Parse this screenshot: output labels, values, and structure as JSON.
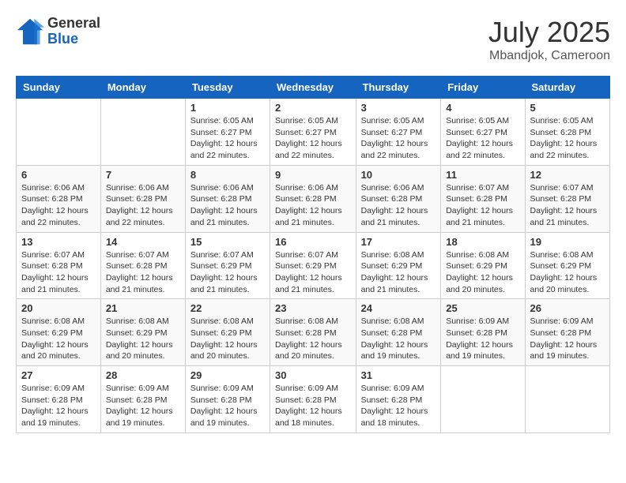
{
  "header": {
    "logo_general": "General",
    "logo_blue": "Blue",
    "month_title": "July 2025",
    "location": "Mbandjok, Cameroon"
  },
  "weekdays": [
    "Sunday",
    "Monday",
    "Tuesday",
    "Wednesday",
    "Thursday",
    "Friday",
    "Saturday"
  ],
  "weeks": [
    [
      {
        "day": "",
        "info": ""
      },
      {
        "day": "",
        "info": ""
      },
      {
        "day": "1",
        "info": "Sunrise: 6:05 AM\nSunset: 6:27 PM\nDaylight: 12 hours and 22 minutes."
      },
      {
        "day": "2",
        "info": "Sunrise: 6:05 AM\nSunset: 6:27 PM\nDaylight: 12 hours and 22 minutes."
      },
      {
        "day": "3",
        "info": "Sunrise: 6:05 AM\nSunset: 6:27 PM\nDaylight: 12 hours and 22 minutes."
      },
      {
        "day": "4",
        "info": "Sunrise: 6:05 AM\nSunset: 6:27 PM\nDaylight: 12 hours and 22 minutes."
      },
      {
        "day": "5",
        "info": "Sunrise: 6:05 AM\nSunset: 6:28 PM\nDaylight: 12 hours and 22 minutes."
      }
    ],
    [
      {
        "day": "6",
        "info": "Sunrise: 6:06 AM\nSunset: 6:28 PM\nDaylight: 12 hours and 22 minutes."
      },
      {
        "day": "7",
        "info": "Sunrise: 6:06 AM\nSunset: 6:28 PM\nDaylight: 12 hours and 22 minutes."
      },
      {
        "day": "8",
        "info": "Sunrise: 6:06 AM\nSunset: 6:28 PM\nDaylight: 12 hours and 21 minutes."
      },
      {
        "day": "9",
        "info": "Sunrise: 6:06 AM\nSunset: 6:28 PM\nDaylight: 12 hours and 21 minutes."
      },
      {
        "day": "10",
        "info": "Sunrise: 6:06 AM\nSunset: 6:28 PM\nDaylight: 12 hours and 21 minutes."
      },
      {
        "day": "11",
        "info": "Sunrise: 6:07 AM\nSunset: 6:28 PM\nDaylight: 12 hours and 21 minutes."
      },
      {
        "day": "12",
        "info": "Sunrise: 6:07 AM\nSunset: 6:28 PM\nDaylight: 12 hours and 21 minutes."
      }
    ],
    [
      {
        "day": "13",
        "info": "Sunrise: 6:07 AM\nSunset: 6:28 PM\nDaylight: 12 hours and 21 minutes."
      },
      {
        "day": "14",
        "info": "Sunrise: 6:07 AM\nSunset: 6:28 PM\nDaylight: 12 hours and 21 minutes."
      },
      {
        "day": "15",
        "info": "Sunrise: 6:07 AM\nSunset: 6:29 PM\nDaylight: 12 hours and 21 minutes."
      },
      {
        "day": "16",
        "info": "Sunrise: 6:07 AM\nSunset: 6:29 PM\nDaylight: 12 hours and 21 minutes."
      },
      {
        "day": "17",
        "info": "Sunrise: 6:08 AM\nSunset: 6:29 PM\nDaylight: 12 hours and 21 minutes."
      },
      {
        "day": "18",
        "info": "Sunrise: 6:08 AM\nSunset: 6:29 PM\nDaylight: 12 hours and 20 minutes."
      },
      {
        "day": "19",
        "info": "Sunrise: 6:08 AM\nSunset: 6:29 PM\nDaylight: 12 hours and 20 minutes."
      }
    ],
    [
      {
        "day": "20",
        "info": "Sunrise: 6:08 AM\nSunset: 6:29 PM\nDaylight: 12 hours and 20 minutes."
      },
      {
        "day": "21",
        "info": "Sunrise: 6:08 AM\nSunset: 6:29 PM\nDaylight: 12 hours and 20 minutes."
      },
      {
        "day": "22",
        "info": "Sunrise: 6:08 AM\nSunset: 6:29 PM\nDaylight: 12 hours and 20 minutes."
      },
      {
        "day": "23",
        "info": "Sunrise: 6:08 AM\nSunset: 6:28 PM\nDaylight: 12 hours and 20 minutes."
      },
      {
        "day": "24",
        "info": "Sunrise: 6:08 AM\nSunset: 6:28 PM\nDaylight: 12 hours and 19 minutes."
      },
      {
        "day": "25",
        "info": "Sunrise: 6:09 AM\nSunset: 6:28 PM\nDaylight: 12 hours and 19 minutes."
      },
      {
        "day": "26",
        "info": "Sunrise: 6:09 AM\nSunset: 6:28 PM\nDaylight: 12 hours and 19 minutes."
      }
    ],
    [
      {
        "day": "27",
        "info": "Sunrise: 6:09 AM\nSunset: 6:28 PM\nDaylight: 12 hours and 19 minutes."
      },
      {
        "day": "28",
        "info": "Sunrise: 6:09 AM\nSunset: 6:28 PM\nDaylight: 12 hours and 19 minutes."
      },
      {
        "day": "29",
        "info": "Sunrise: 6:09 AM\nSunset: 6:28 PM\nDaylight: 12 hours and 19 minutes."
      },
      {
        "day": "30",
        "info": "Sunrise: 6:09 AM\nSunset: 6:28 PM\nDaylight: 12 hours and 18 minutes."
      },
      {
        "day": "31",
        "info": "Sunrise: 6:09 AM\nSunset: 6:28 PM\nDaylight: 12 hours and 18 minutes."
      },
      {
        "day": "",
        "info": ""
      },
      {
        "day": "",
        "info": ""
      }
    ]
  ]
}
